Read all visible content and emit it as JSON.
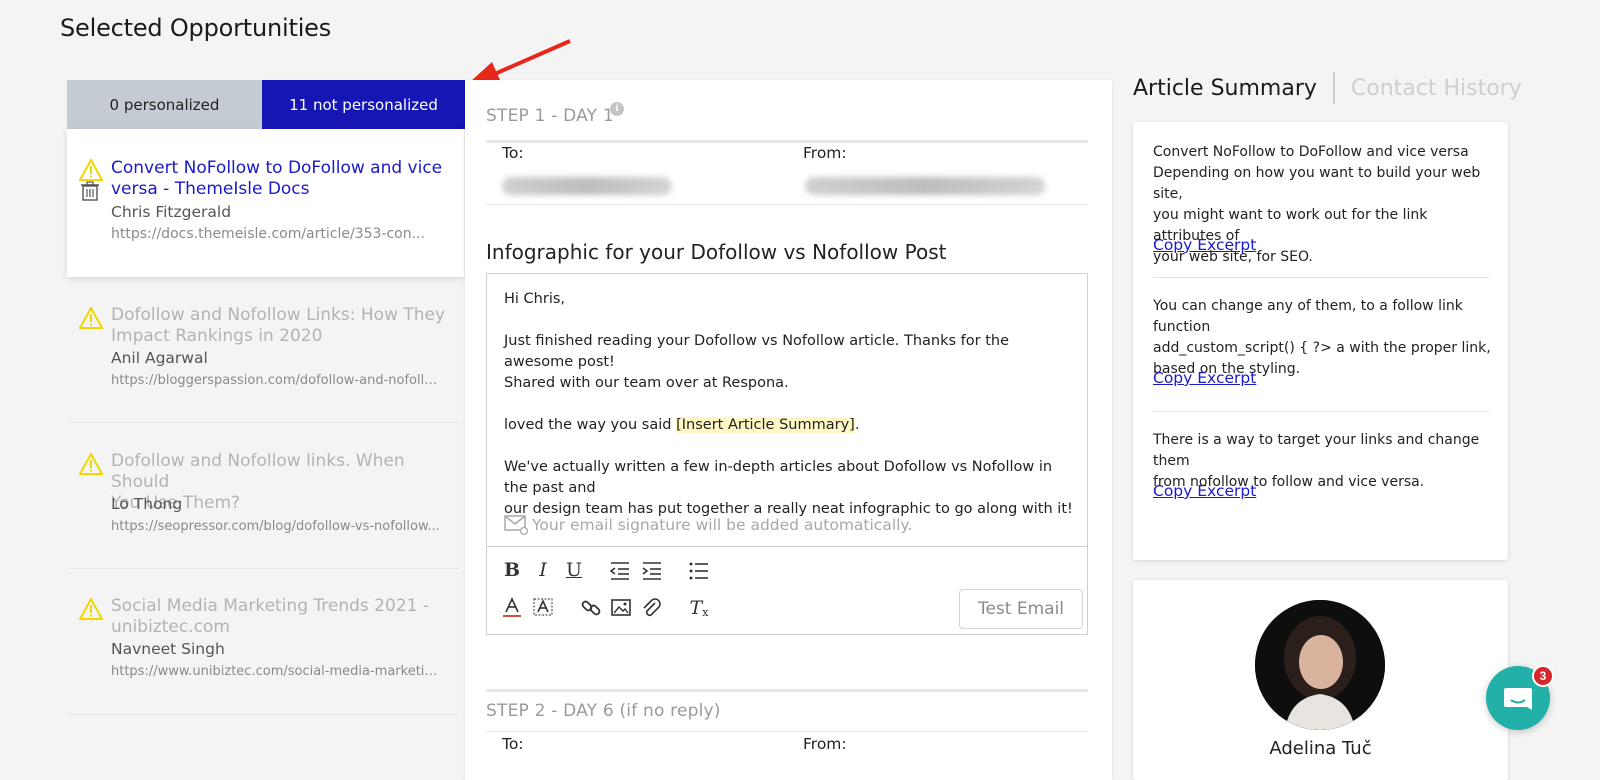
{
  "page": {
    "title": "Selected Opportunities"
  },
  "tabs": {
    "personalized": "0 personalized",
    "not_personalized": "11 not personalized"
  },
  "opportunities": [
    {
      "title": "Convert NoFollow to DoFollow and vice versa - ThemeIsle Docs",
      "title_line1": "Convert NoFollow to DoFollow and vice",
      "title_line2": "versa - ThemeIsle Docs",
      "author": "Chris Fitzgerald",
      "url": "https://docs.themeisle.com/article/353-con...",
      "active": true
    },
    {
      "title_line1": "Dofollow and Nofollow Links: How They",
      "title_line2": "Impact Rankings in 2020",
      "author": "Anil Agarwal",
      "url": "https://bloggerspassion.com/dofollow-and-nofollo..."
    },
    {
      "title_line1": "Dofollow and Nofollow links. When Should",
      "title_line2": "You Use Them?",
      "author": "Lo Thong",
      "url": "https://seopressor.com/blog/dofollow-vs-nofollow..."
    },
    {
      "title_line1": "Social Media Marketing Trends 2021 -",
      "title_line2": "unibiztec.com",
      "author": "Navneet Singh",
      "url": "https://www.unibiztec.com/social-media-marketing..."
    }
  ],
  "email": {
    "step1_title": "STEP 1 - DAY 1",
    "to_label": "To:",
    "from_label": "From:",
    "subject": "Infographic for your Dofollow vs Nofollow Post",
    "greeting": "Hi Chris,",
    "para1_line1": "Just finished reading your Dofollow vs Nofollow article. Thanks for the awesome post!",
    "para1_line2": "Shared with our team over at Respona.",
    "para2_prefix": "loved the way you said ",
    "para2_placeholder": "[Insert Article Summary]",
    "para2_suffix": ".",
    "para3_line1": "We've actually written a few in-depth articles about Dofollow vs Nofollow in the past and",
    "para3_line2": "our design team has put together a really neat infographic to go along with it!",
    "signature_note": "Your email signature will be added automatically.",
    "test_email_label": "Test Email",
    "step2_title": "STEP 2 - DAY 6 (if no reply)"
  },
  "right": {
    "tab_active": "Article Summary",
    "tab_inactive": "Contact History",
    "excerpts": [
      {
        "lines": [
          "Convert NoFollow to DoFollow and vice versa",
          "Depending on how you want to build your web site,",
          "you might want to work out for the link attributes of",
          "your web site, for SEO."
        ],
        "copy": "Copy Excerpt"
      },
      {
        "lines": [
          "You can change any of them, to a follow link function",
          "add_custom_script() { ?> a with the proper link,",
          "based on the styling."
        ],
        "copy": "Copy Excerpt"
      },
      {
        "lines": [
          "There is a way to target your links and change them",
          "from nofollow to follow and vice versa."
        ],
        "copy": "Copy Excerpt"
      }
    ],
    "contact_name": "Adelina Tuč"
  },
  "chat": {
    "badge_count": "3"
  },
  "colors": {
    "accent": "#1616b4",
    "link": "#1a1ac8",
    "warning": "#f2d600",
    "chat": "#23b0a8"
  }
}
